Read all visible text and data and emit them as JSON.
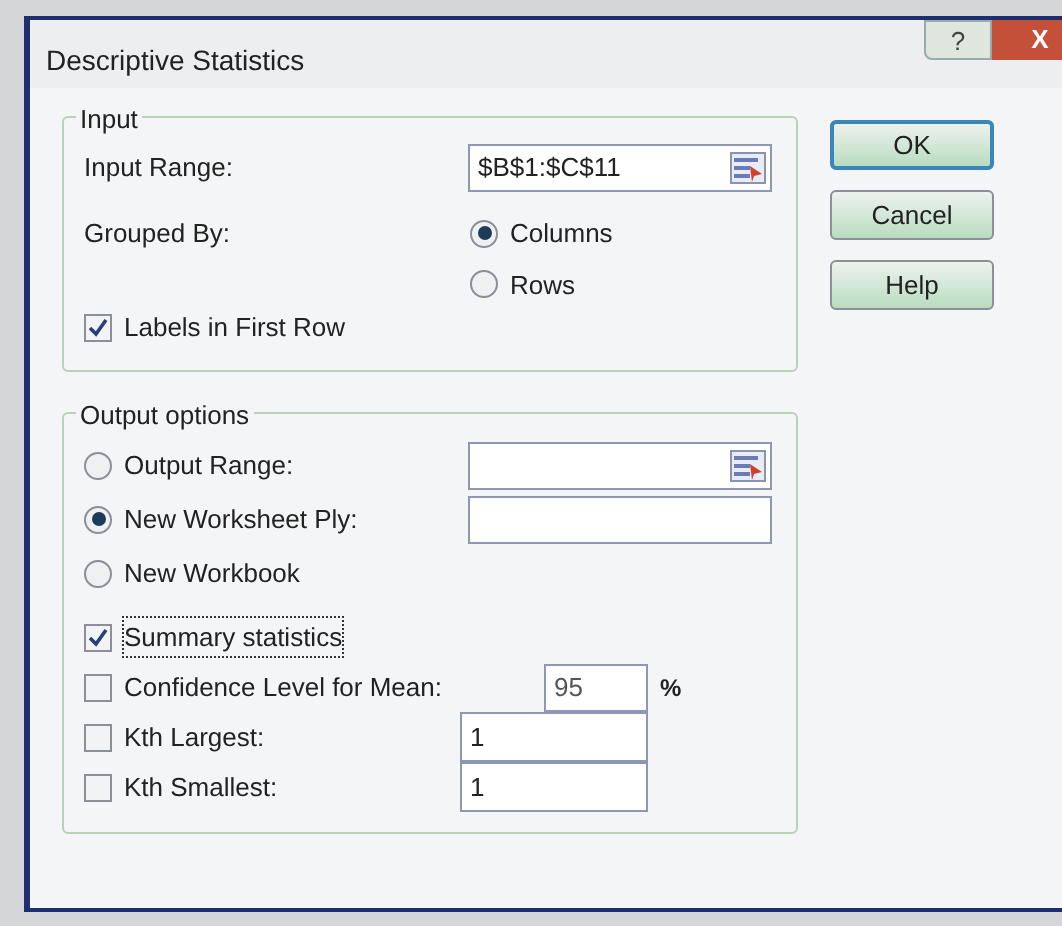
{
  "window": {
    "title": "Descriptive Statistics",
    "help_button": "?",
    "close_button": "X"
  },
  "input": {
    "title": "Input",
    "input_range": {
      "label": "Input Range:",
      "value": "$B$1:$C$11"
    },
    "grouped_by": {
      "label": "Grouped By:",
      "options": [
        {
          "label": "Columns",
          "selected": true
        },
        {
          "label": "Rows",
          "selected": false
        }
      ]
    },
    "labels_in_first_row": {
      "label": "Labels in First Row",
      "checked": true
    }
  },
  "output": {
    "title": "Output options",
    "destinations": [
      {
        "label": "Output Range:",
        "selected": false,
        "kind": "range"
      },
      {
        "label": "New Worksheet Ply:",
        "selected": true,
        "kind": "text"
      },
      {
        "label": "New Workbook",
        "selected": false,
        "kind": "none"
      }
    ],
    "options": [
      {
        "label": "Summary statistics",
        "checked": true,
        "focused": true,
        "kind": "plain"
      },
      {
        "label": "Confidence Level for Mean:",
        "checked": false,
        "focused": false,
        "kind": "percent",
        "value": "95",
        "unit": "%"
      },
      {
        "label": "Kth Largest:",
        "checked": false,
        "focused": false,
        "kind": "number",
        "value": "1"
      },
      {
        "label": "Kth Smallest:",
        "checked": false,
        "focused": false,
        "kind": "number",
        "value": "1"
      }
    ]
  },
  "buttons": [
    {
      "label": "OK",
      "default": true
    },
    {
      "label": "Cancel",
      "default": false
    },
    {
      "label": "Help",
      "default": false
    }
  ]
}
